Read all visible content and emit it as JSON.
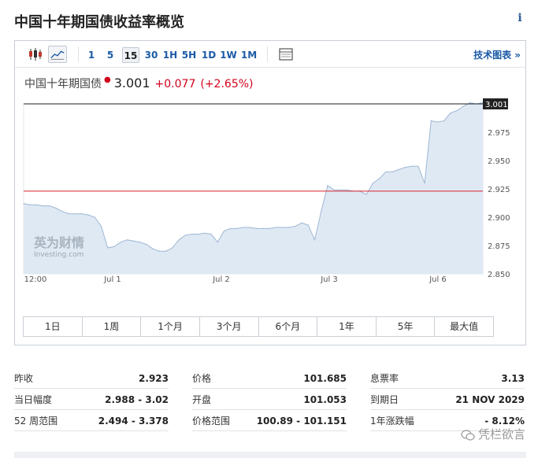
{
  "page": {
    "title": "中国十年期国债收益率概览",
    "info_icon": "i"
  },
  "toolbar": {
    "timeframes": [
      "1",
      "5",
      "15",
      "30",
      "1H",
      "5H",
      "1D",
      "1W",
      "1M"
    ],
    "active_timeframe": "15",
    "tech_chart_link": "技术图表 »"
  },
  "quote": {
    "name": "中国十年期国债",
    "price": "3.001",
    "change": "+0.077",
    "change_pct": "(+2.65%)"
  },
  "watermark_logo": {
    "line1": "英为财情",
    "line2": "Investing.com"
  },
  "colors": {
    "accent_blue": "#1b5aa6",
    "up_red": "#d0021b",
    "area_fill": "#dfe9f4",
    "area_line": "#9db7d3",
    "ref_line": "#d9232d"
  },
  "chart_data": {
    "type": "area",
    "y_axis_side": "right",
    "ylim": [
      2.85,
      3.0
    ],
    "y_ticks": [
      "2.850",
      "2.875",
      "2.900",
      "2.925",
      "2.950",
      "2.975"
    ],
    "x_tick_labels": [
      "12:00",
      "Jul 1",
      "Jul 2",
      "Jul 3",
      "Jul 6"
    ],
    "last_value_label": "3.001",
    "reference_line_value": 2.923,
    "series": [
      {
        "values": [
          2.912,
          2.911,
          2.911,
          2.91,
          2.91,
          2.908,
          2.905,
          2.903,
          2.903,
          2.903,
          2.902,
          2.9,
          2.892,
          2.873,
          2.874,
          2.878,
          2.88,
          2.879,
          2.878,
          2.876,
          2.872,
          2.87,
          2.87,
          2.873,
          2.88,
          2.884,
          2.885,
          2.885,
          2.886,
          2.885,
          2.878,
          2.888,
          2.89,
          2.89,
          2.891,
          2.891,
          2.89,
          2.89,
          2.89,
          2.891,
          2.891,
          2.891,
          2.892,
          2.895,
          2.893,
          2.88,
          2.905,
          2.928,
          2.924,
          2.924,
          2.924,
          2.923,
          2.923,
          2.92,
          2.93,
          2.934,
          2.94,
          2.94,
          2.942,
          2.944,
          2.945,
          2.945,
          2.93,
          2.985,
          2.984,
          2.985,
          2.992,
          2.994,
          2.998,
          3.001,
          3.0,
          3.001
        ]
      }
    ]
  },
  "ranges": [
    "1日",
    "1周",
    "1个月",
    "3个月",
    "6个月",
    "1年",
    "5年",
    "最大值"
  ],
  "stats": [
    [
      {
        "label": "昨收",
        "value": "2.923"
      },
      {
        "label": "价格",
        "value": "101.685"
      },
      {
        "label": "息票率",
        "value": "3.13"
      }
    ],
    [
      {
        "label": "当日幅度",
        "value": "2.988 - 3.02"
      },
      {
        "label": "开盘",
        "value": "101.053"
      },
      {
        "label": "到期日",
        "value": "21 NOV 2029"
      }
    ],
    [
      {
        "label": "52 周范围",
        "value": "2.494 - 3.378"
      },
      {
        "label": "价格范围",
        "value": "100.89 - 101.151"
      },
      {
        "label": "1年涨跌幅",
        "value": "- 8.12%"
      }
    ]
  ],
  "watermark": "凭栏欲言"
}
